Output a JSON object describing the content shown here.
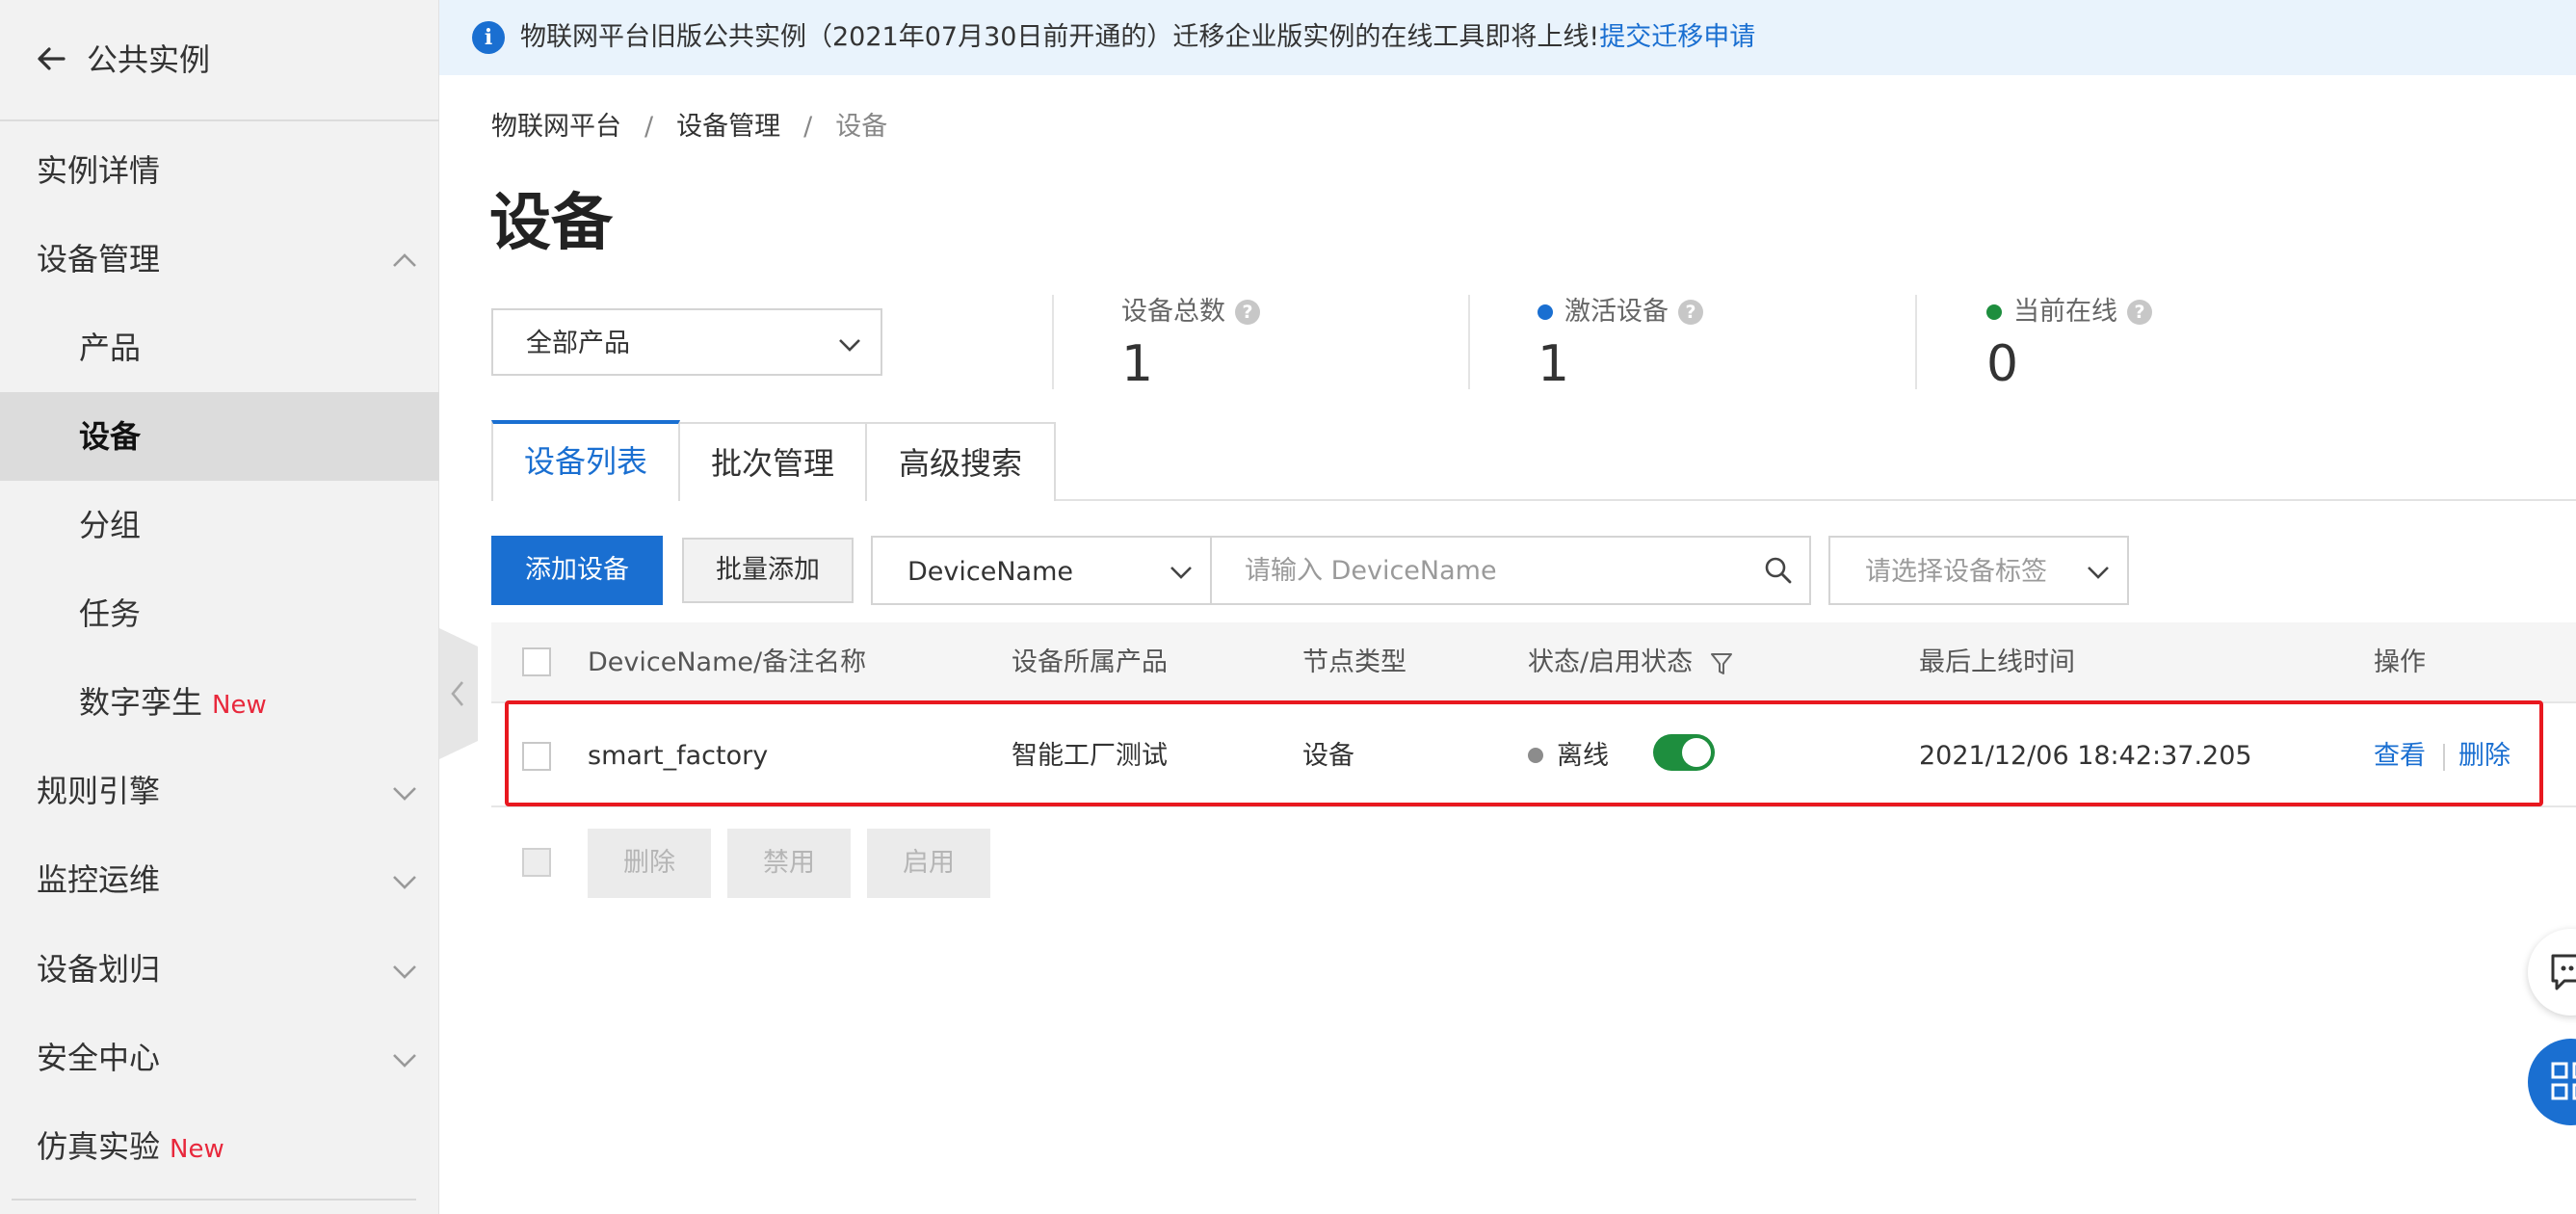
{
  "sidebar": {
    "back_title": "公共实例",
    "items": [
      {
        "label": "实例详情"
      },
      {
        "label": "设备管理"
      },
      {
        "label": "产品"
      },
      {
        "label": "设备"
      },
      {
        "label": "分组"
      },
      {
        "label": "任务"
      },
      {
        "label": "数字孪生",
        "badge": "New"
      },
      {
        "label": "规则引擎"
      },
      {
        "label": "监控运维"
      },
      {
        "label": "设备划归"
      },
      {
        "label": "安全中心"
      },
      {
        "label": "仿真实验",
        "badge": "New"
      }
    ]
  },
  "banner": {
    "text": "物联网平台旧版公共实例（2021年07月30日前开通的）迁移企业版实例的在线工具即将上线!",
    "link": "提交迁移申请"
  },
  "breadcrumb": [
    "物联网平台",
    "设备管理",
    "设备"
  ],
  "page_title": "设备",
  "product_filter": {
    "value": "全部产品"
  },
  "stats": [
    {
      "label": "设备总数",
      "value": "1"
    },
    {
      "label": "激活设备",
      "value": "1",
      "dot_color": "#1a6fd1"
    },
    {
      "label": "当前在线",
      "value": "0",
      "dot_color": "#1e8e3e"
    }
  ],
  "tabs": [
    {
      "label": "设备列表",
      "active": true
    },
    {
      "label": "批次管理",
      "active": false
    },
    {
      "label": "高级搜索",
      "active": false
    }
  ],
  "toolbar": {
    "add_device": "添加设备",
    "batch_add": "批量添加",
    "field_select": "DeviceName",
    "search_placeholder": "请输入 DeviceName",
    "tag_placeholder": "请选择设备标签"
  },
  "table": {
    "columns": [
      "DeviceName/备注名称",
      "设备所属产品",
      "节点类型",
      "状态/启用状态",
      "最后上线时间",
      "操作"
    ],
    "rows": [
      {
        "device_name": "smart_factory",
        "product": "智能工厂测试",
        "node_type": "设备",
        "status": "离线",
        "enabled": true,
        "last_online": "2021/12/06 18:42:37.205",
        "actions": [
          "查看",
          "删除"
        ]
      }
    ]
  },
  "bulk_actions": [
    "删除",
    "禁用",
    "启用"
  ],
  "colors": {
    "primary": "#1a6fd1",
    "online_green": "#1e8e3e",
    "highlight_red": "#e8181f",
    "new_badge": "#e8283c"
  }
}
